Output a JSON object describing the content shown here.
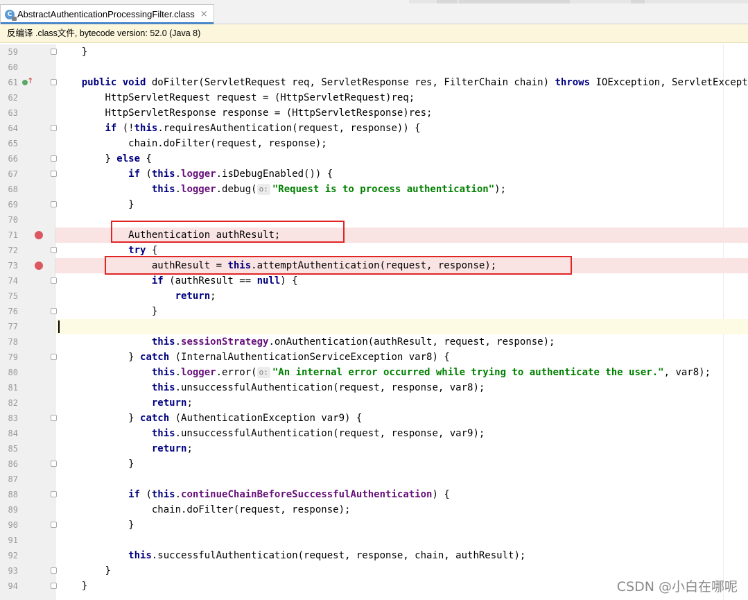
{
  "tab": {
    "title": "AbstractAuthenticationProcessingFilter.class",
    "icon": "java-class-icon"
  },
  "notice": "反编译 .class文件, bytecode version: 52.0 (Java 8)",
  "watermark": "CSDN @小白在哪呢",
  "colors": {
    "keyword": "#000080",
    "field": "#660e7a",
    "string": "#008000",
    "breakpoint": "#db5860",
    "breakpoint_line": "#fae3e3",
    "highlight_box": "#e02525",
    "caret_line": "#fdfbe4"
  },
  "lines": [
    {
      "n": "59",
      "indent": 1,
      "tokens": [
        [
          "p",
          "}"
        ]
      ]
    },
    {
      "n": "60",
      "indent": 0,
      "tokens": []
    },
    {
      "n": "61",
      "indent": 1,
      "tokens": [
        [
          "k",
          "public"
        ],
        [
          "p",
          " "
        ],
        [
          "k",
          "void"
        ],
        [
          "p",
          " doFilter(ServletRequest req, ServletResponse res, FilterChain chain) "
        ],
        [
          "k",
          "throws"
        ],
        [
          "p",
          " IOException, ServletException {"
        ]
      ]
    },
    {
      "n": "62",
      "indent": 2,
      "tokens": [
        [
          "p",
          "HttpServletRequest request = (HttpServletRequest)req;"
        ]
      ]
    },
    {
      "n": "63",
      "indent": 2,
      "tokens": [
        [
          "p",
          "HttpServletResponse response = (HttpServletResponse)res;"
        ]
      ]
    },
    {
      "n": "64",
      "indent": 2,
      "tokens": [
        [
          "k",
          "if"
        ],
        [
          "p",
          " (!"
        ],
        [
          "k",
          "this"
        ],
        [
          "p",
          ".requiresAuthentication(request, response)) {"
        ]
      ]
    },
    {
      "n": "65",
      "indent": 3,
      "tokens": [
        [
          "p",
          "chain.doFilter(request, response);"
        ]
      ]
    },
    {
      "n": "66",
      "indent": 2,
      "tokens": [
        [
          "p",
          "} "
        ],
        [
          "k",
          "else"
        ],
        [
          "p",
          " {"
        ]
      ]
    },
    {
      "n": "67",
      "indent": 3,
      "tokens": [
        [
          "k",
          "if"
        ],
        [
          "p",
          " ("
        ],
        [
          "k",
          "this"
        ],
        [
          "p",
          "."
        ],
        [
          "f",
          "logger"
        ],
        [
          "p",
          ".isDebugEnabled()) {"
        ]
      ]
    },
    {
      "n": "68",
      "indent": 4,
      "tokens": [
        [
          "k",
          "this"
        ],
        [
          "p",
          "."
        ],
        [
          "f",
          "logger"
        ],
        [
          "p",
          ".debug("
        ],
        [
          "h",
          "o:"
        ],
        [
          "s",
          "\"Request is to process authentication\""
        ],
        [
          "p",
          ");"
        ]
      ]
    },
    {
      "n": "69",
      "indent": 3,
      "tokens": [
        [
          "p",
          "}"
        ]
      ]
    },
    {
      "n": "70",
      "indent": 0,
      "tokens": []
    },
    {
      "n": "71",
      "indent": 3,
      "tokens": [
        [
          "p",
          "Authentication authResult;"
        ]
      ]
    },
    {
      "n": "72",
      "indent": 3,
      "tokens": [
        [
          "k",
          "try"
        ],
        [
          "p",
          " {"
        ]
      ]
    },
    {
      "n": "73",
      "indent": 4,
      "tokens": [
        [
          "p",
          "authResult = "
        ],
        [
          "k",
          "this"
        ],
        [
          "p",
          ".attemptAuthentication(request, response);"
        ]
      ]
    },
    {
      "n": "74",
      "indent": 4,
      "tokens": [
        [
          "k",
          "if"
        ],
        [
          "p",
          " (authResult == "
        ],
        [
          "k",
          "null"
        ],
        [
          "p",
          ") {"
        ]
      ]
    },
    {
      "n": "75",
      "indent": 5,
      "tokens": [
        [
          "k",
          "return"
        ],
        [
          "p",
          ";"
        ]
      ]
    },
    {
      "n": "76",
      "indent": 4,
      "tokens": [
        [
          "p",
          "}"
        ]
      ]
    },
    {
      "n": "77",
      "indent": 0,
      "tokens": []
    },
    {
      "n": "78",
      "indent": 4,
      "tokens": [
        [
          "k",
          "this"
        ],
        [
          "p",
          "."
        ],
        [
          "f",
          "sessionStrategy"
        ],
        [
          "p",
          ".onAuthentication(authResult, request, response);"
        ]
      ]
    },
    {
      "n": "79",
      "indent": 3,
      "tokens": [
        [
          "p",
          "} "
        ],
        [
          "k",
          "catch"
        ],
        [
          "p",
          " (InternalAuthenticationServiceException var8) {"
        ]
      ]
    },
    {
      "n": "80",
      "indent": 4,
      "tokens": [
        [
          "k",
          "this"
        ],
        [
          "p",
          "."
        ],
        [
          "f",
          "logger"
        ],
        [
          "p",
          ".error("
        ],
        [
          "h",
          "o:"
        ],
        [
          "s",
          "\"An internal error occurred while trying to authenticate the user.\""
        ],
        [
          "p",
          ", var8);"
        ]
      ]
    },
    {
      "n": "81",
      "indent": 4,
      "tokens": [
        [
          "k",
          "this"
        ],
        [
          "p",
          ".unsuccessfulAuthentication(request, response, var8);"
        ]
      ]
    },
    {
      "n": "82",
      "indent": 4,
      "tokens": [
        [
          "k",
          "return"
        ],
        [
          "p",
          ";"
        ]
      ]
    },
    {
      "n": "83",
      "indent": 3,
      "tokens": [
        [
          "p",
          "} "
        ],
        [
          "k",
          "catch"
        ],
        [
          "p",
          " (AuthenticationException var9) {"
        ]
      ]
    },
    {
      "n": "84",
      "indent": 4,
      "tokens": [
        [
          "k",
          "this"
        ],
        [
          "p",
          ".unsuccessfulAuthentication(request, response, var9);"
        ]
      ]
    },
    {
      "n": "85",
      "indent": 4,
      "tokens": [
        [
          "k",
          "return"
        ],
        [
          "p",
          ";"
        ]
      ]
    },
    {
      "n": "86",
      "indent": 3,
      "tokens": [
        [
          "p",
          "}"
        ]
      ]
    },
    {
      "n": "87",
      "indent": 0,
      "tokens": []
    },
    {
      "n": "88",
      "indent": 3,
      "tokens": [
        [
          "k",
          "if"
        ],
        [
          "p",
          " ("
        ],
        [
          "k",
          "this"
        ],
        [
          "p",
          "."
        ],
        [
          "f",
          "continueChainBeforeSuccessfulAuthentication"
        ],
        [
          "p",
          ") {"
        ]
      ]
    },
    {
      "n": "89",
      "indent": 4,
      "tokens": [
        [
          "p",
          "chain.doFilter(request, response);"
        ]
      ]
    },
    {
      "n": "90",
      "indent": 3,
      "tokens": [
        [
          "p",
          "}"
        ]
      ]
    },
    {
      "n": "91",
      "indent": 0,
      "tokens": []
    },
    {
      "n": "92",
      "indent": 3,
      "tokens": [
        [
          "k",
          "this"
        ],
        [
          "p",
          ".successfulAuthentication(request, response, chain, authResult);"
        ]
      ]
    },
    {
      "n": "93",
      "indent": 2,
      "tokens": [
        [
          "p",
          "}"
        ]
      ]
    },
    {
      "n": "94",
      "indent": 1,
      "tokens": [
        [
          "p",
          "}"
        ]
      ]
    }
  ],
  "breakpoint_lines": [
    "71",
    "73"
  ],
  "caret_line": "77",
  "override_marker_line": "61",
  "fold_markers": [
    "59",
    "61",
    "64",
    "66",
    "67",
    "69",
    "72",
    "74",
    "76",
    "79",
    "83",
    "86",
    "88",
    "90",
    "93",
    "94"
  ],
  "highlight_box_lines": [
    "71",
    "73"
  ]
}
